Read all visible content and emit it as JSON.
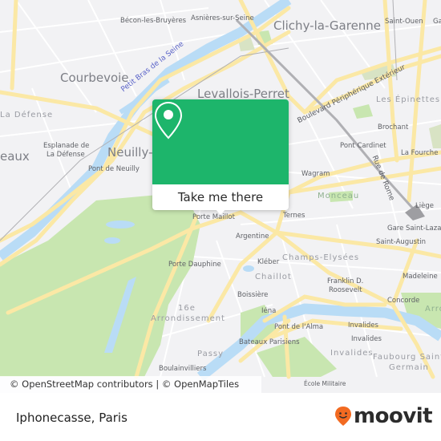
{
  "map": {
    "colors": {
      "land": "#f2f2f4",
      "water": "#b9dcf6",
      "park": "#c8e6b0",
      "road_major": "#fbe8a5",
      "road_minor": "#ffffff",
      "rail": "#b0b0b4",
      "brand_green": "#1db56b",
      "brand_orange": "#f26a21"
    },
    "labels": {
      "becon": "Bécon-les-Bruyères",
      "asnieres": "Asnières-sur-Seine",
      "clichy": "Clichy-la-Garenne",
      "saint_ouen": "Saint-Ouen",
      "ga": "Ga",
      "courbevoie": "Courbevoie",
      "petit_bras": "Petit Bras de la Seine",
      "levallois": "Levallois-Perret",
      "boulevard": "Boulevard Périphérique Extérieur",
      "la_defense": "La Défense",
      "les_epinettes": "Les Épinettes",
      "brochant": "Brochant",
      "esplanade1": "Esplanade de",
      "esplanade2": "La Défense",
      "eaux": "eaux",
      "neuilly": "Neuilly-",
      "pont_cardinet": "Pont Cardinet",
      "la_fourche": "La Fourche",
      "rue_de_rome": "Rue de Rome",
      "pont_de_neuilly": "Pont de Neuilly",
      "wagram": "Wagram",
      "monceau": "Monceau",
      "liege": "Liège",
      "porte_maillot": "Porte Maillot",
      "ternes": "Ternes",
      "gare_saint_lazare": "Gare Saint-Lazare",
      "argentine": "Argentine",
      "saint_augustin": "Saint-Augustin",
      "champs_elysees": "Champs-Elysées",
      "porte_dauphine": "Porte Dauphine",
      "kleber": "Kléber",
      "chaillot": "Chaillot",
      "madeleine": "Madeleine",
      "franklin1": "Franklin D.",
      "franklin2": "Roosevelt",
      "boissiere": "Boissière",
      "concorde": "Concorde",
      "arr16_1": "16e",
      "arr16_2": "Arrondissement",
      "iena": "Iéna",
      "arro": "Arro",
      "pont_alma": "Pont de l'Alma",
      "invalides_1": "Invalides",
      "invalides_2": "Invalides",
      "invalides_3": "Invalides",
      "bateaux": "Bateaux Parisiens",
      "passy": "Passy",
      "faubourg1": "Faubourg Saint-",
      "faubourg2": "Germain",
      "boulainvilliers": "Boulainvilliers",
      "ecole_militaire": "École Militaire"
    }
  },
  "popup": {
    "icon": "location-pin-icon",
    "action_label": "Take me there"
  },
  "attribution": "© OpenStreetMap contributors | © OpenMapTiles",
  "footer": {
    "place_name": "Iphonecasse, Paris",
    "brand": "moovit"
  }
}
